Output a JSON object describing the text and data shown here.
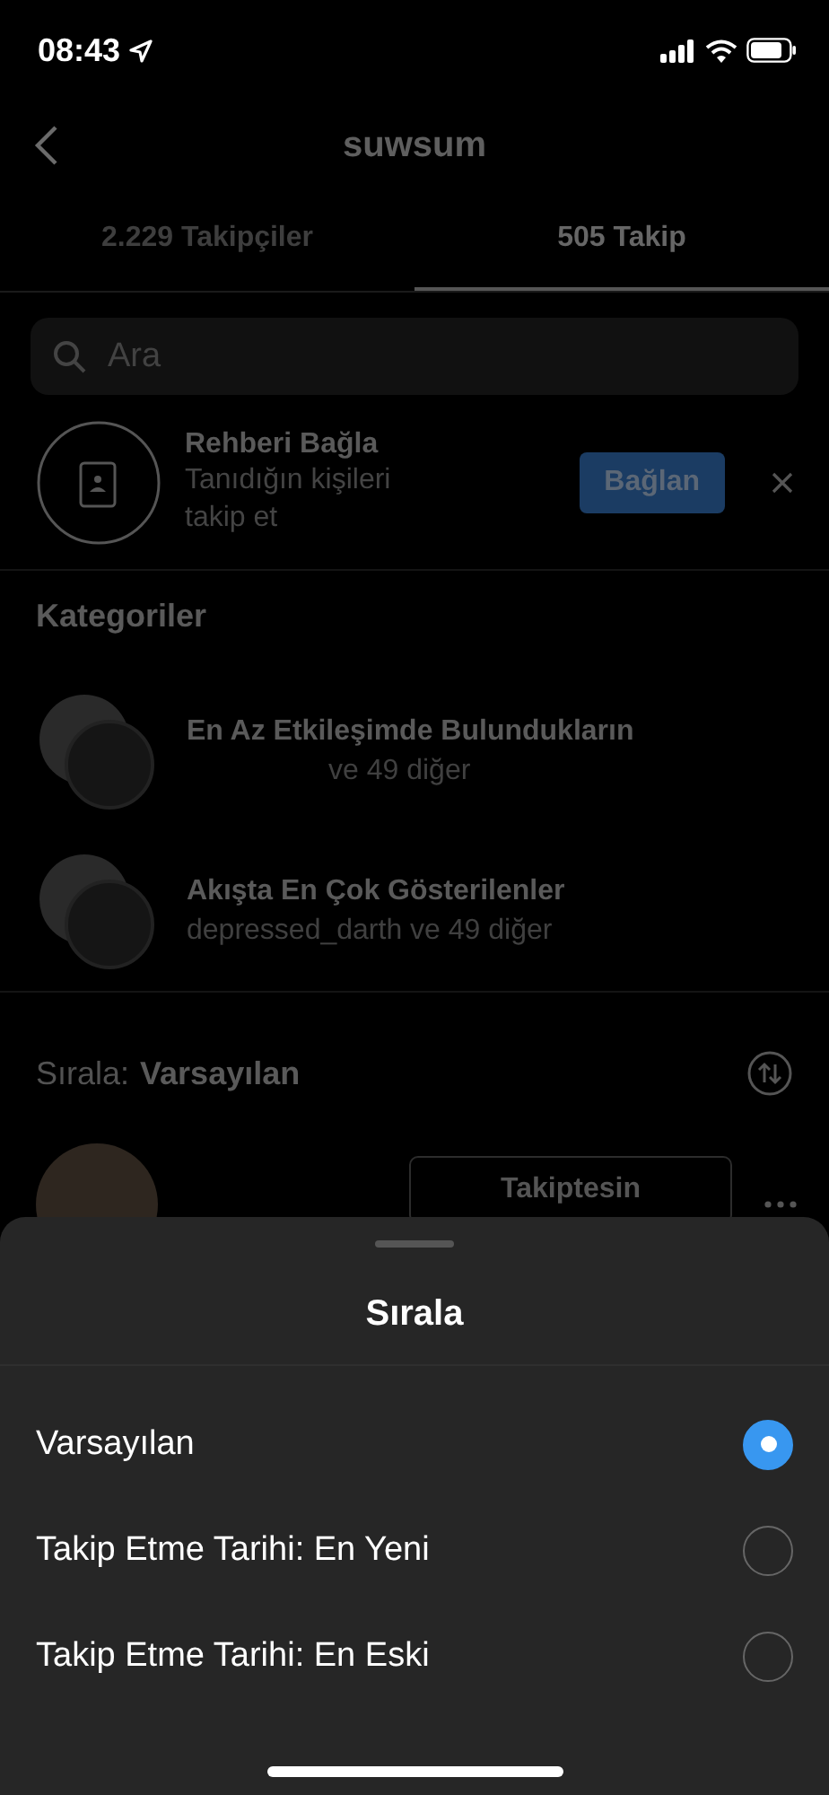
{
  "status_bar": {
    "time": "08:43"
  },
  "header": {
    "title": "suwsum"
  },
  "tabs": [
    {
      "label": "2.229 Takipçiler",
      "selected": false
    },
    {
      "label": "505 Takip",
      "selected": true
    }
  ],
  "search": {
    "placeholder": "Ara"
  },
  "contacts_card": {
    "title": "Rehberi Bağla",
    "subtitle": "Tanıdığın kişileri takip et",
    "button": "Bağlan"
  },
  "categories": {
    "heading": "Kategoriler",
    "items": [
      {
        "title": "En Az Etkileşimde Bulundukların",
        "subtitle": "ve 49 diğer"
      },
      {
        "title": "Akışta En Çok Gösterilenler",
        "subtitle": "depressed_darth ve 49 diğer"
      }
    ]
  },
  "sort": {
    "label": "Sırala:",
    "value": "Varsayılan"
  },
  "following_row": {
    "button": "Takiptesin"
  },
  "sheet": {
    "title": "Sırala",
    "options": [
      {
        "label": "Varsayılan",
        "selected": true
      },
      {
        "label": "Takip Etme Tarihi: En Yeni",
        "selected": false
      },
      {
        "label": "Takip Etme Tarihi: En Eski",
        "selected": false
      }
    ]
  }
}
